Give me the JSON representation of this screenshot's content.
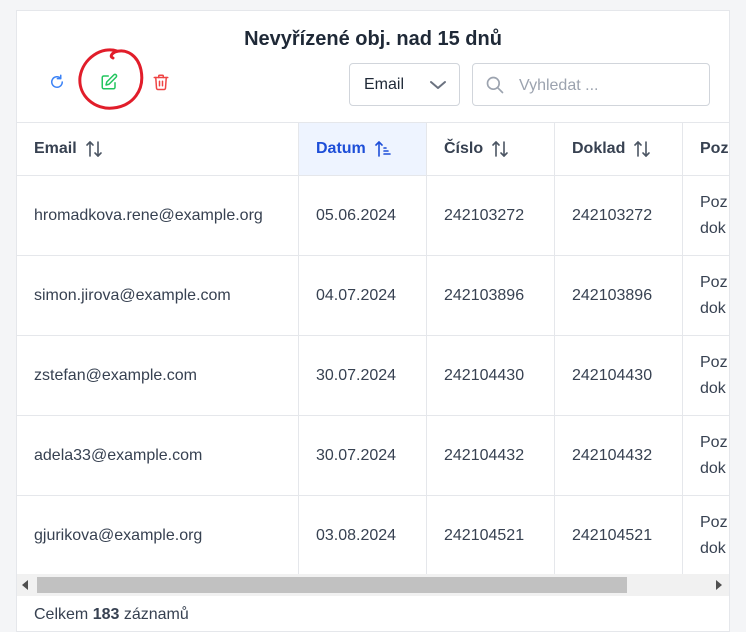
{
  "header": {
    "title": "Nevyřízené obj. nad 15 dnů"
  },
  "toolbar": {
    "refresh_icon": "refresh-icon",
    "edit_icon": "edit-icon",
    "delete_icon": "trash-icon",
    "colors": {
      "refresh": "#3b82f6",
      "edit": "#22c55e",
      "delete": "#ef4444",
      "annotation": "#e11d2a"
    }
  },
  "filter": {
    "selected": "Email"
  },
  "search": {
    "placeholder": "Vyhledat ..."
  },
  "table": {
    "columns": [
      "Email",
      "Datum",
      "Číslo",
      "Doklad",
      "Poz"
    ],
    "sorted_column": "Datum",
    "rows": [
      {
        "email": "hromadkova.rene@example.org",
        "datum": "05.06.2024",
        "cislo": "242103272",
        "doklad": "242103272",
        "poz1": "Poz",
        "poz2": "dok"
      },
      {
        "email": "simon.jirova@example.com",
        "datum": "04.07.2024",
        "cislo": "242103896",
        "doklad": "242103896",
        "poz1": "Poz",
        "poz2": "dok"
      },
      {
        "email": "zstefan@example.com",
        "datum": "30.07.2024",
        "cislo": "242104430",
        "doklad": "242104430",
        "poz1": "Poz",
        "poz2": "dok"
      },
      {
        "email": "adela33@example.com",
        "datum": "30.07.2024",
        "cislo": "242104432",
        "doklad": "242104432",
        "poz1": "Poz",
        "poz2": "dok"
      },
      {
        "email": "gjurikova@example.org",
        "datum": "03.08.2024",
        "cislo": "242104521",
        "doklad": "242104521",
        "poz1": "Poz",
        "poz2": "dok"
      }
    ]
  },
  "footer": {
    "prefix": "Celkem",
    "count": "183",
    "suffix": "záznamů"
  }
}
